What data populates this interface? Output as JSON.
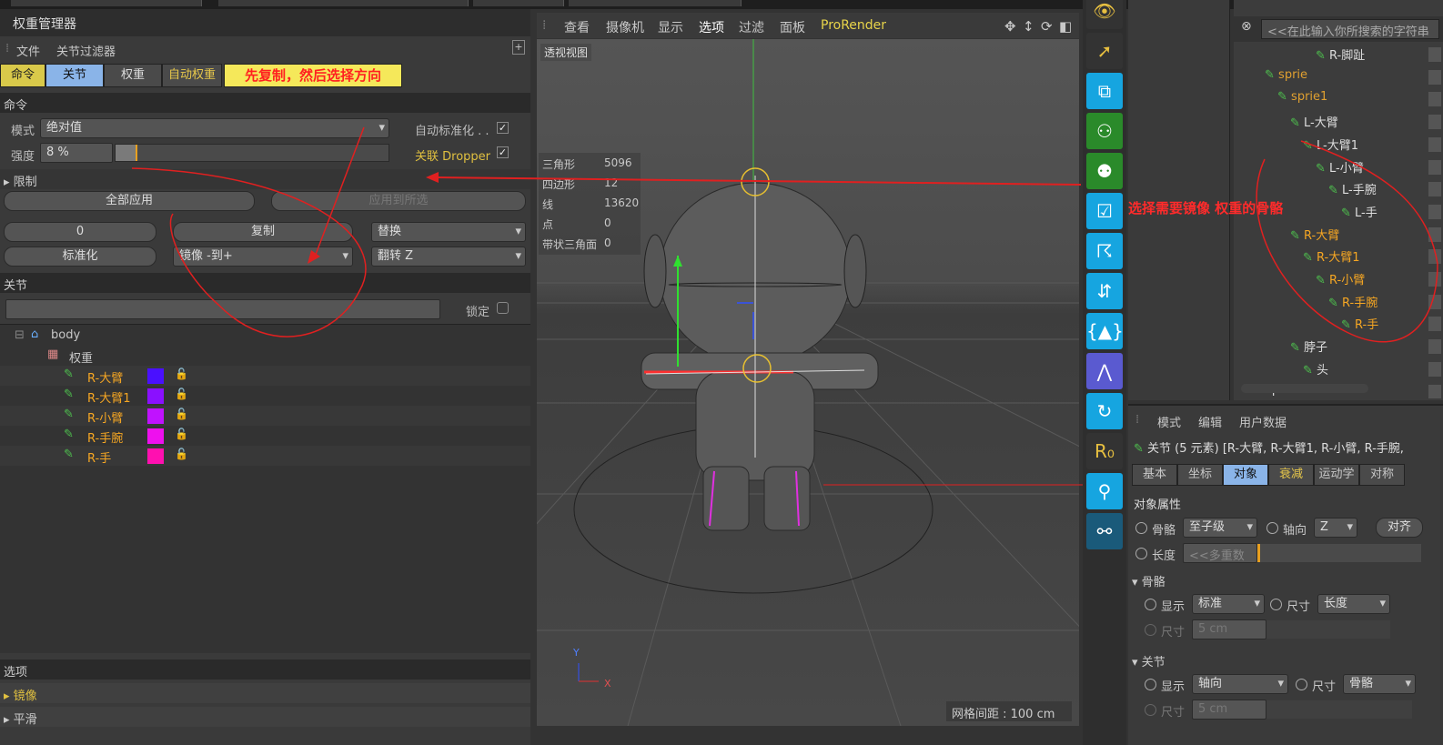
{
  "panel": {
    "title": "权重管理器",
    "menu": [
      "文件",
      "关节过滤器"
    ],
    "tabs": [
      "命令",
      "关节",
      "权重",
      "自动权重"
    ],
    "annotation_tabs": "先复制，然后选择方向",
    "cmd_header": "命令",
    "mode_label": "模式",
    "mode_value": "绝对值",
    "auto_normalize": "自动标准化 . .",
    "strength_label": "强度",
    "strength_value": "8 %",
    "strength_level": 0.08,
    "link_dropper": "关联 Dropper",
    "limit": "限制",
    "apply_all": "全部应用",
    "apply_selected": "应用到所选",
    "zero_btn": "0",
    "copy_btn": "复制",
    "replace_dd": "替换",
    "normalize_btn": "标准化",
    "mirror_dd": "镜像 -到+",
    "flip_dd": "翻转 Z",
    "joints_header": "关节",
    "lock_label": "锁定",
    "tree": {
      "root": "body",
      "weight": "权重",
      "joints": [
        {
          "name": "R-大臂",
          "color": "#4a10ff"
        },
        {
          "name": "R-大臂1",
          "color": "#8a10ff"
        },
        {
          "name": "R-小臂",
          "color": "#c012ff"
        },
        {
          "name": "R-手腕",
          "color": "#ee10ee"
        },
        {
          "name": "R-手",
          "color": "#ff10b0"
        }
      ]
    },
    "options_header": "选项",
    "mirror_section": "镜像",
    "smooth_section": "平滑"
  },
  "viewport": {
    "menu": [
      "查看",
      "摄像机",
      "显示",
      "选项",
      "过滤",
      "面板",
      "ProRender"
    ],
    "label": "透视视图",
    "stats": [
      {
        "k": "三角形",
        "v": "5096"
      },
      {
        "k": "四边形",
        "v": "12"
      },
      {
        "k": "线",
        "v": "13620"
      },
      {
        "k": "点",
        "v": "0"
      },
      {
        "k": "带状三角面",
        "v": "0"
      }
    ],
    "grid": "网格间距 : 100 cm",
    "axis_y": "Y",
    "axis_x": "X"
  },
  "annotation_right": "选择需要镜像 权重的骨骼",
  "objects": {
    "search_placeholder": "<<在此输入你所搜索的字符串",
    "items": [
      {
        "name": "R-脚趾",
        "color": "#ddd",
        "depth": 5
      },
      {
        "name": "sprie",
        "color": "#e0a030",
        "depth": 1
      },
      {
        "name": "sprie1",
        "color": "#e0a030",
        "depth": 2
      },
      {
        "name": "L-大臂",
        "color": "#ddd",
        "depth": 3
      },
      {
        "name": "L-大臂1",
        "color": "#ddd",
        "depth": 4
      },
      {
        "name": "L-小臂",
        "color": "#ddd",
        "depth": 5
      },
      {
        "name": "L-手腕",
        "color": "#ddd",
        "depth": 6
      },
      {
        "name": "L-手",
        "color": "#ddd",
        "depth": 7
      },
      {
        "name": "R-大臂",
        "color": "#f5a623",
        "depth": 3
      },
      {
        "name": "R-大臂1",
        "color": "#f5a623",
        "depth": 4
      },
      {
        "name": "R-小臂",
        "color": "#f5a623",
        "depth": 5
      },
      {
        "name": "R-手腕",
        "color": "#f5a623",
        "depth": 6
      },
      {
        "name": "R-手",
        "color": "#f5a623",
        "depth": 7
      },
      {
        "name": "脖子",
        "color": "#ddd",
        "depth": 3
      },
      {
        "name": "头",
        "color": "#ddd",
        "depth": 4
      },
      {
        "name": "sprie",
        "color": "#ddd",
        "depth": 0
      }
    ]
  },
  "attributes": {
    "menu": [
      "模式",
      "编辑",
      "用户数据"
    ],
    "title": "关节 (5 元素) [R-大臂, R-大臂1, R-小臂, R-手腕,",
    "tabs": [
      "基本",
      "坐标",
      "对象",
      "衰减",
      "运动学",
      "对称"
    ],
    "obj_props": "对象属性",
    "bone_label": "骨骼",
    "bone_value": "至子级",
    "axis_label": "轴向",
    "axis_value": "Z",
    "align_btn": "对齐",
    "length_label": "长度",
    "length_value": "<<多重数",
    "bone_section": "骨骼",
    "display_label": "显示",
    "display_value": "标准",
    "size_label": "尺寸",
    "size_value": "长度",
    "size_field": "5 cm",
    "joint_section": "关节",
    "jdisplay_value": "轴向",
    "jsize_value": "骨骼",
    "jsize_field": "5 cm"
  }
}
